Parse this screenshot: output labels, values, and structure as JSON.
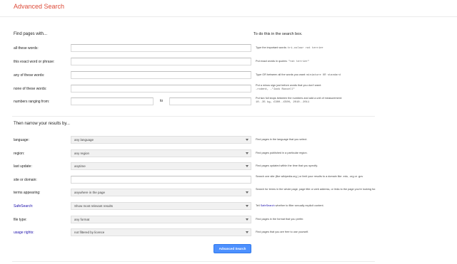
{
  "header": {
    "title": "Advanced Search"
  },
  "find_section": {
    "heading": "Find pages with...",
    "hint_heading": "To do this in the search box.",
    "rows": [
      {
        "label": "all these words:",
        "value": "",
        "hint_pre": "Type the important words: ",
        "hint_code": "tri-colour rat terrier",
        "hint_post": ""
      },
      {
        "label": "this exact word or phrase:",
        "value": "",
        "hint_pre": "Put exact words in quotes: ",
        "hint_code": "\"rat terrier\"",
        "hint_post": ""
      },
      {
        "label": "any of these words:",
        "value": "",
        "hint_pre": "Type OR between all the words you want: ",
        "hint_code": "miniature OR standard",
        "hint_post": ""
      },
      {
        "label": "none of these words:",
        "value": "",
        "hint_pre": "Put a minus sign just before words that you don't want:",
        "hint_code": "-rodent, -\"Jack Russell\"",
        "hint_post": ""
      },
      {
        "label": "numbers ranging from:",
        "value": "",
        "hint_pre": "Put two full stops between the numbers and add a unit of measurement:",
        "hint_code": "10..35 kg, £300..£500, 2010..2011",
        "hint_post": ""
      }
    ],
    "to_label": "to"
  },
  "narrow_section": {
    "heading": "Then narrow your results by...",
    "rows": [
      {
        "label": "language:",
        "value": "any language",
        "hint": "Find pages in the language that you select."
      },
      {
        "label": "region:",
        "value": "any region",
        "hint": "Find pages published in a particular region."
      },
      {
        "label": "last update:",
        "value": "anytime",
        "hint": "Find pages updated within the time that you specify."
      },
      {
        "label": "site or domain:",
        "value": "",
        "hint": "Search one site (like wikipedia.org ) or limit your results to a domain like .edu, .org or .gov"
      },
      {
        "label": "terms appearing:",
        "value": "anywhere in the page",
        "hint": "Search for terms in the whole page, page title or web address, or links to the page you're looking for."
      },
      {
        "label": "SafeSearch:",
        "value": "Show most relevant results",
        "hint_pre": "Tell ",
        "hint_link": "SafeSearch",
        "hint_post": " whether to filter sexually explicit content."
      },
      {
        "label": "file type:",
        "value": "any format",
        "hint": "Find pages in the format that you prefer."
      },
      {
        "label": "usage rights:",
        "value": "not filtered by licence",
        "hint": "Find pages that you are free to use yourself."
      }
    ]
  },
  "submit": {
    "label": "Advanced Search"
  },
  "colors": {
    "title": "#dd4b39",
    "link": "#1a0dab",
    "button": "#4d90fe"
  }
}
